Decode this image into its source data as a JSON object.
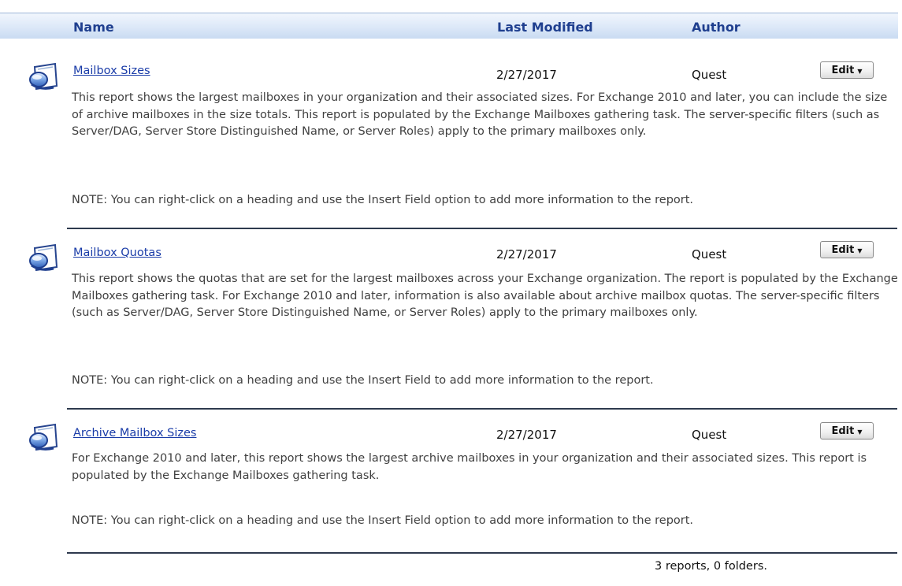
{
  "columns": {
    "name": "Name",
    "last_modified": "Last Modified",
    "author": "Author"
  },
  "reports": [
    {
      "name": "Mailbox Sizes",
      "last_modified": "2/27/2017",
      "author": "Quest",
      "edit_label": "Edit",
      "description": "This report shows the largest mailboxes in your organization and their associated sizes. For Exchange 2010 and later, you can include the size of archive mailboxes in the size totals. This report is populated by the Exchange Mailboxes gathering task. The server-specific filters (such as Server/DAG, Server Store Distinguished Name, or Server Roles) apply to the primary mailboxes only.",
      "note": "NOTE: You can right-click on a heading and use the Insert Field option to add more information to the report."
    },
    {
      "name": "Mailbox Quotas",
      "last_modified": "2/27/2017",
      "author": "Quest",
      "edit_label": "Edit",
      "description": "This report shows the quotas that are set for the largest mailboxes across your Exchange organization. The report is populated by the Exchange Mailboxes gathering task. For Exchange 2010 and later, information is also available about archive mailbox quotas. The server-specific filters (such as Server/DAG, Server Store Distinguished Name, or Server Roles) apply to the primary mailboxes only.",
      "note": "NOTE: You can right-click on a heading and use the Insert Field to add more information to the report."
    },
    {
      "name": "Archive Mailbox Sizes",
      "last_modified": "2/27/2017",
      "author": "Quest",
      "edit_label": "Edit",
      "description": "For Exchange 2010 and later, this report shows the largest archive mailboxes in your organization and their associated sizes. This report is populated by the Exchange Mailboxes gathering task.",
      "note": "NOTE: You can right-click on a heading and use the Insert Field option to add more information to the report."
    }
  ],
  "footer": {
    "summary": "3 reports, 0 folders."
  },
  "icons": {
    "report": "report-icon",
    "dropdown": "caret-down-icon"
  },
  "colors": {
    "link": "#1a3ca8",
    "header_text": "#1f3f8f",
    "header_bg": "#dce8f8"
  }
}
